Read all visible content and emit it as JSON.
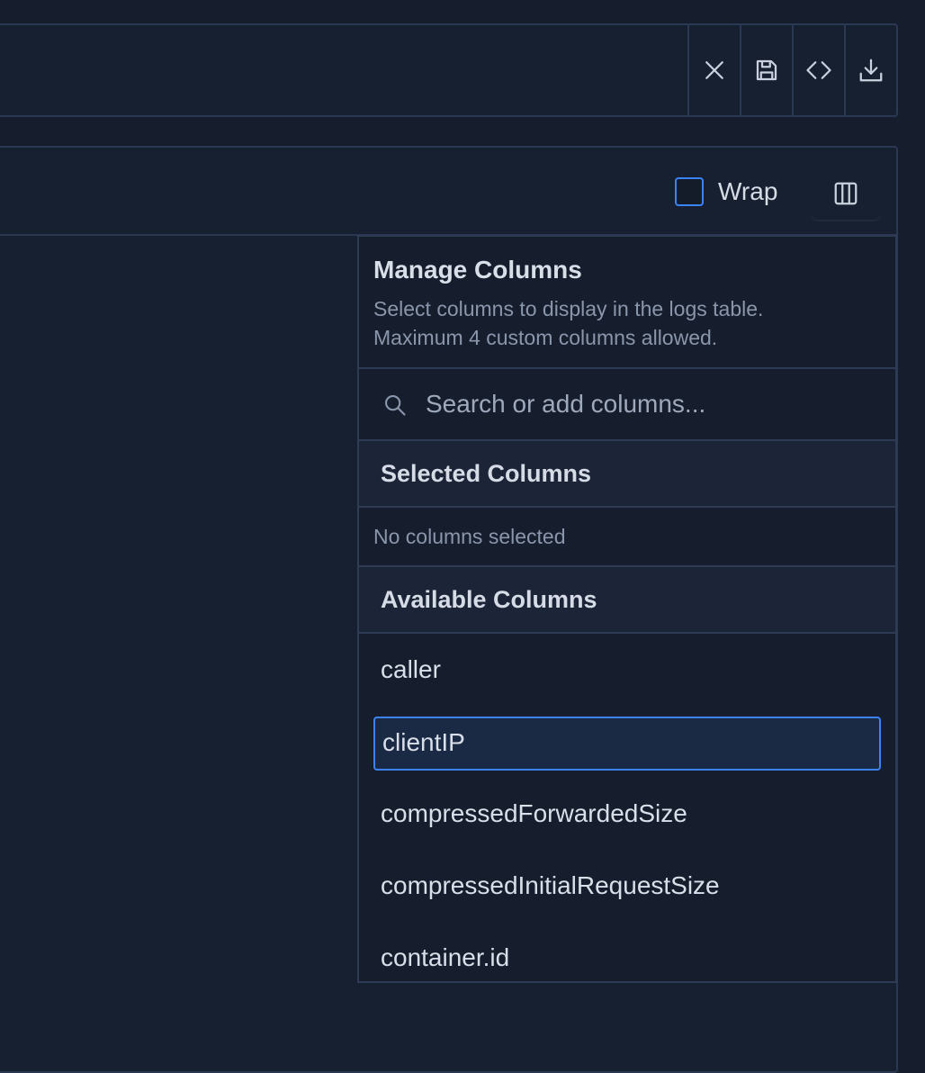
{
  "toolbar": {
    "buttons": [
      {
        "icon": "close-icon"
      },
      {
        "icon": "save-icon"
      },
      {
        "icon": "code-icon"
      },
      {
        "icon": "download-icon"
      }
    ]
  },
  "panel": {
    "wrap_label": "Wrap",
    "wrap_checked": false
  },
  "manage_columns": {
    "title": "Manage Columns",
    "description_line1": "Select columns to display in the logs table.",
    "description_line2": "Maximum 4 custom columns allowed.",
    "search_placeholder": "Search or add columns...",
    "selected_heading": "Selected Columns",
    "selected_empty": "No columns selected",
    "available_heading": "Available Columns",
    "available": [
      "caller",
      "clientIP",
      "compressedForwardedSize",
      "compressedInitialRequestSize",
      "container.id"
    ],
    "focused_item": "clientIP"
  },
  "colors": {
    "background": "#161e2d",
    "border": "#2b3852",
    "accent": "#3b82f6",
    "text": "#d9dfe9",
    "muted": "#8a96ab"
  }
}
